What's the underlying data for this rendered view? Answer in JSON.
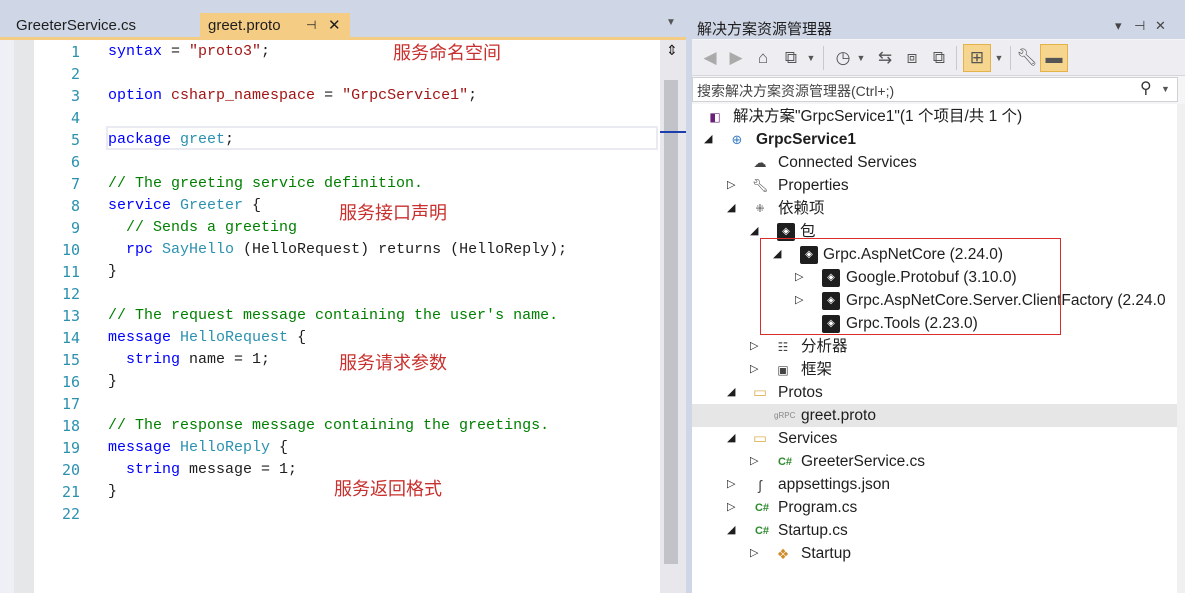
{
  "editor": {
    "tabs": [
      {
        "label": "GreeterService.cs",
        "active": false
      },
      {
        "label": "greet.proto",
        "active": true,
        "pin": "⊣",
        "close": "✕"
      }
    ],
    "line_numbers": [
      "1",
      "2",
      "3",
      "4",
      "5",
      "6",
      "7",
      "8",
      "9",
      "10",
      "11",
      "12",
      "13",
      "14",
      "15",
      "16",
      "17",
      "18",
      "19",
      "20",
      "21",
      "22"
    ],
    "lines": {
      "l1": {
        "kw": "syntax",
        "op": " = ",
        "str": "\"proto3\"",
        "end": ";"
      },
      "l3": {
        "kw": "option",
        "mid": " ",
        "name": "csharp_namespace",
        "op": " = ",
        "str": "\"GrpcService1\"",
        "end": ";"
      },
      "l5": {
        "kw": "package",
        "mid": " ",
        "name": "greet",
        "end": ";"
      },
      "l7": "// The greeting service definition.",
      "l8": {
        "kw": "service",
        "mid": " ",
        "name": "Greeter",
        "end": " {"
      },
      "l9": "// Sends a greeting",
      "l10": {
        "kw": "rpc",
        "mid": " ",
        "name": "SayHello",
        "rest": " (HelloRequest) returns (HelloReply);"
      },
      "l11": "}",
      "l13": "// The request message containing the user's name.",
      "l14": {
        "kw": "message",
        "mid": " ",
        "name": "HelloRequest",
        "end": " {"
      },
      "l15": {
        "kw": "string",
        "rest": " name = 1;"
      },
      "l16": "}",
      "l18": "// The response message containing the greetings.",
      "l19": {
        "kw": "message",
        "mid": " ",
        "name": "HelloReply",
        "end": " {"
      },
      "l20": {
        "kw": "string",
        "rest": " message = 1;"
      },
      "l21": "}"
    },
    "annotations": {
      "namespace": "服务命名空间",
      "interface": "服务接口声明",
      "request": "服务请求参数",
      "response": "服务返回格式"
    }
  },
  "solution_explorer": {
    "title": "解决方案资源管理器",
    "search_placeholder": "搜索解决方案资源管理器(Ctrl+;)",
    "tree": {
      "solution": "解决方案\"GrpcService1\"(1 个项目/共 1 个)",
      "project": "GrpcService1",
      "connected_services": "Connected Services",
      "properties": "Properties",
      "dependencies": "依赖项",
      "packages": "包",
      "pkg_aspnetcore": "Grpc.AspNetCore (2.24.0)",
      "pkg_protobuf": "Google.Protobuf (3.10.0)",
      "pkg_clientfactory": "Grpc.AspNetCore.Server.ClientFactory (2.24.0",
      "pkg_tools": "Grpc.Tools (2.23.0)",
      "analyzers": "分析器",
      "frameworks": "框架",
      "protos": "Protos",
      "greet_proto": "greet.proto",
      "services": "Services",
      "greeter_service": "GreeterService.cs",
      "appsettings": "appsettings.json",
      "program": "Program.cs",
      "startup_cs": "Startup.cs",
      "startup_class": "Startup"
    }
  },
  "icons": {
    "cs": "C#",
    "grpc": "gRPC"
  }
}
